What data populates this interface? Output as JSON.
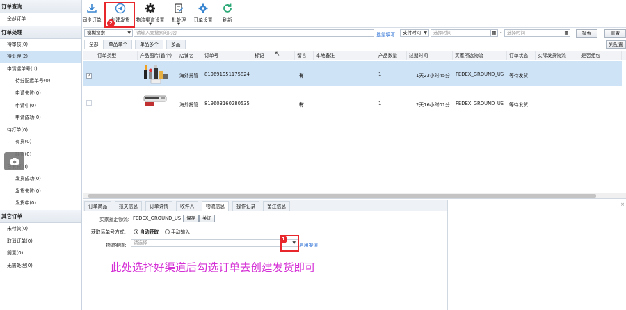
{
  "sidebar": {
    "sections": [
      {
        "title": "订单查询",
        "items": [
          {
            "label": "全部订单",
            "sub": false
          }
        ]
      },
      {
        "title": "订单处理",
        "items": [
          {
            "label": "待审核(0)",
            "sub": false
          },
          {
            "label": "待处理(2)",
            "sub": false,
            "active": true
          },
          {
            "label": "申请运单号(0)",
            "sub": false
          },
          {
            "label": "待分配运单号(0)",
            "sub": true
          },
          {
            "label": "申请失败(0)",
            "sub": true
          },
          {
            "label": "申请中(0)",
            "sub": true
          },
          {
            "label": "申请成功(0)",
            "sub": true
          },
          {
            "label": "待打单(0)",
            "sub": false
          },
          {
            "label": "有货(0)",
            "sub": true
          },
          {
            "label": "缺货(0)",
            "sub": true
          },
          {
            "label": "已发货(0)",
            "sub": false
          },
          {
            "label": "发货成功(0)",
            "sub": true
          },
          {
            "label": "发货失败(0)",
            "sub": true
          },
          {
            "label": "发货中(0)",
            "sub": true
          }
        ]
      },
      {
        "title": "其它订单",
        "items": [
          {
            "label": "未付款(0)",
            "sub": false
          },
          {
            "label": "取消订单(0)",
            "sub": false
          },
          {
            "label": "搁置(0)",
            "sub": false
          },
          {
            "label": "无需处理(0)",
            "sub": false
          }
        ]
      }
    ]
  },
  "toolbar": {
    "sync": "同步订单",
    "create_ship": "创建发货",
    "logistics_settings": "物流渠道设置",
    "batch": "批处理",
    "order_settings": "订单设置",
    "refresh": "刷新",
    "badge2": "2"
  },
  "search": {
    "mode": "模糊搜索",
    "keyword_placeholder": "请输入要搜索的内容",
    "batch_fill": "批量填写",
    "pay_time": "支付时间",
    "start_placeholder": "选择时间",
    "dash": "-",
    "end_placeholder": "选择时间",
    "search_btn": "搜索",
    "reset_btn": "重置"
  },
  "tabs": [
    "全部",
    "单品单个",
    "单品多个",
    "多品"
  ],
  "column_config": "列配置",
  "grid": {
    "headers": [
      "订单类型",
      "产品图片(首个)",
      "店铺名",
      "订单号",
      "标记",
      "留言",
      "本地备注",
      "产品数量",
      "过期时间",
      "买家所选物流",
      "订单状态",
      "实际发货物流",
      "是否组包"
    ],
    "rows": [
      {
        "store": "海外托管",
        "order_no": "819691951175824",
        "message": "有",
        "qty": "1",
        "expire": "1天23小时45分",
        "logistics": "FEDEX_GROUND_US",
        "status": "等待发货",
        "checked": true
      },
      {
        "store": "海外托管",
        "order_no": "819603160280535",
        "message": "有",
        "qty": "1",
        "expire": "2天16小时01分",
        "logistics": "FEDEX_GROUND_US",
        "status": "等待发货",
        "checked": false
      }
    ]
  },
  "bottom_tabs": [
    "订单商品",
    "报关信息",
    "订单详情",
    "收件人",
    "物流信息",
    "操作记录",
    "备注信息"
  ],
  "logistics": {
    "buyer_label": "买家指定物流:",
    "buyer_value": "FEDEX_GROUND_US",
    "save": "保存",
    "close": "关闭",
    "get_method_label": "获取运单号方式:",
    "auto": "自动获取",
    "manual": "手动输入",
    "channel_label": "物流渠道:",
    "channel_placeholder": "请选择",
    "enable_channel": "启用渠道",
    "badge1": "1"
  },
  "note": "此处选择好渠道后勾选订单去创建发货即可",
  "colors": {
    "accent_red": "#e8272c",
    "note_magenta": "#d530d5",
    "selected_row": "#cfe3f7",
    "link_blue": "#2a6fd6"
  }
}
